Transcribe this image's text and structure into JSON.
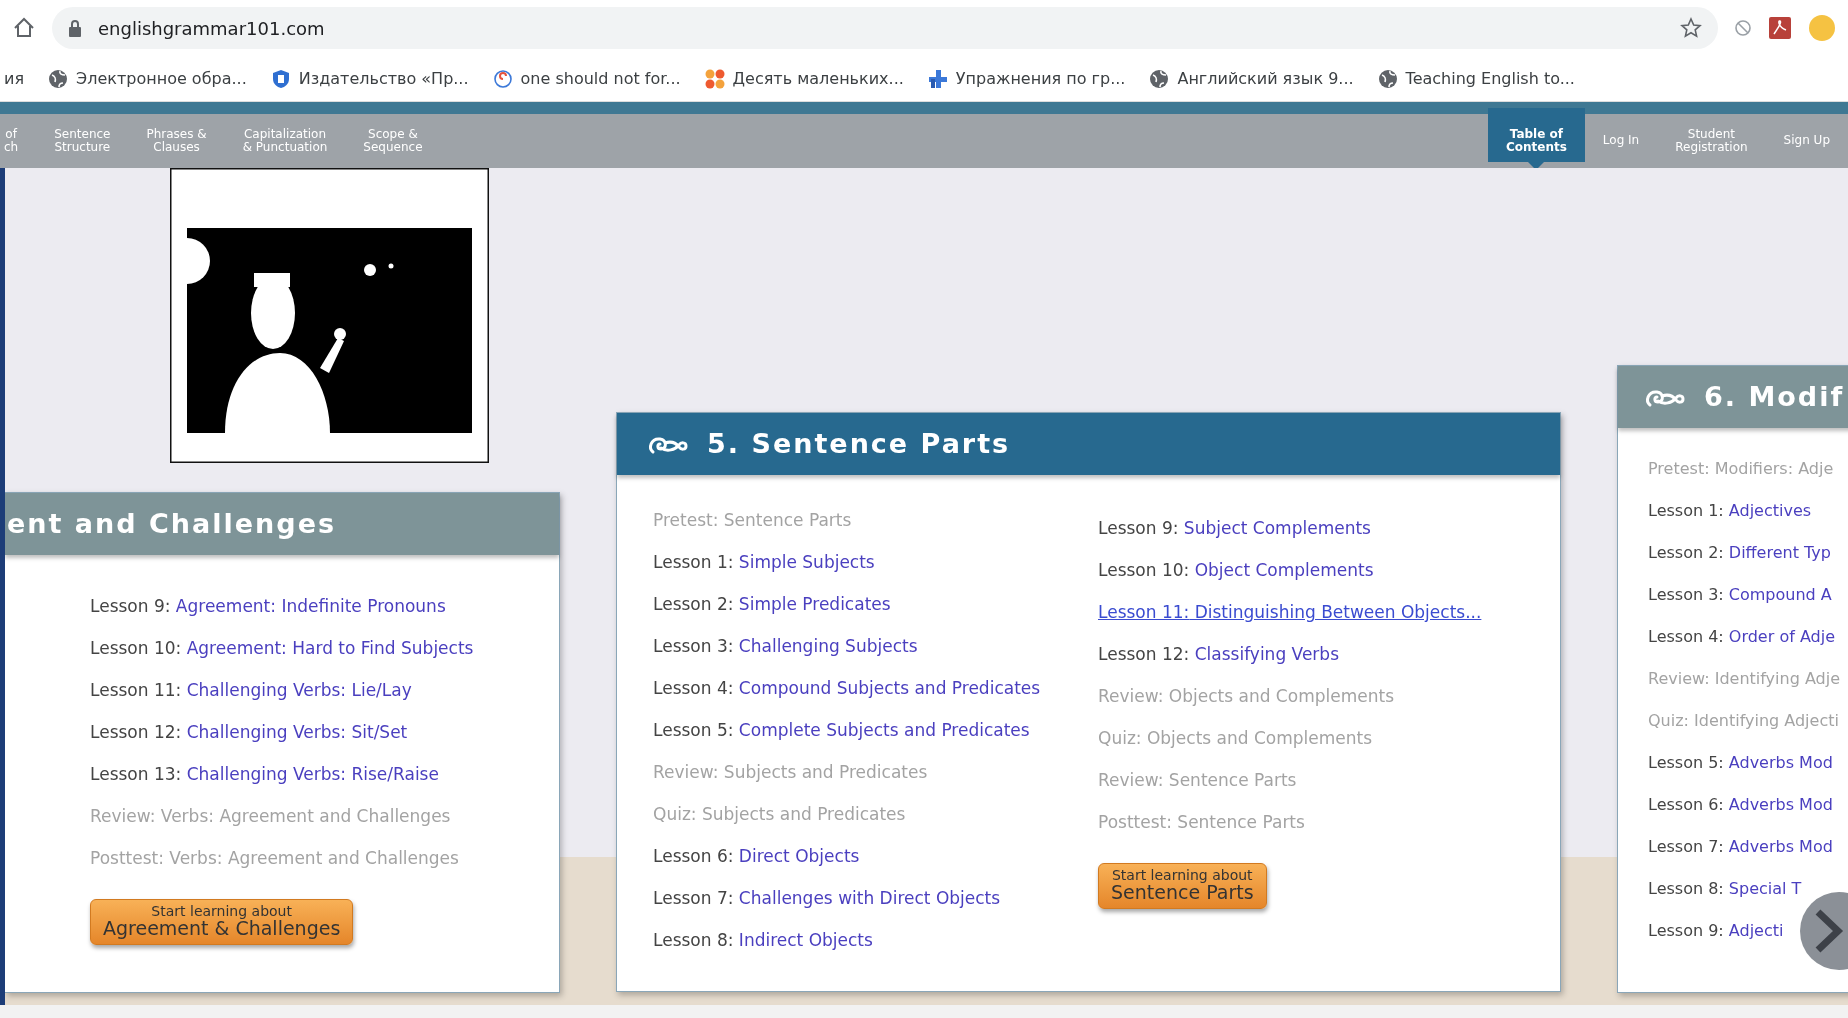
{
  "browser": {
    "url": "englishgrammar101.com",
    "bookmarks": [
      {
        "kind": "plain",
        "label": "ия"
      },
      {
        "kind": "globe",
        "label": "Электронное обра..."
      },
      {
        "kind": "shield",
        "label": "Издательство «Пр..."
      },
      {
        "kind": "spiral",
        "label": "one should not for..."
      },
      {
        "kind": "dots",
        "label": "Десять маленьких..."
      },
      {
        "kind": "cross",
        "label": "Упражнения по гр..."
      },
      {
        "kind": "globe",
        "label": "Английский язык 9..."
      },
      {
        "kind": "globe",
        "label": "Teaching English to..."
      }
    ]
  },
  "nav": {
    "left": [
      {
        "lines": [
          "of",
          "ch"
        ],
        "selected": false
      },
      {
        "lines": [
          "Sentence",
          "Structure"
        ],
        "selected": false
      },
      {
        "lines": [
          "Phrases &",
          "Clauses"
        ],
        "selected": false
      },
      {
        "lines": [
          "Capitalization",
          "& Punctuation"
        ],
        "selected": false
      },
      {
        "lines": [
          "Scope &",
          "Sequence"
        ],
        "selected": false
      }
    ],
    "right": [
      {
        "lines": [
          "Table of",
          "Contents"
        ],
        "selected": true
      },
      {
        "lines": [
          "Log In"
        ],
        "selected": false
      },
      {
        "lines": [
          "Student",
          "Registration"
        ],
        "selected": false
      },
      {
        "lines": [
          "Sign Up"
        ],
        "selected": false
      }
    ]
  },
  "units": [
    {
      "title": "ent and Challenges",
      "icon_shown": false,
      "active": false,
      "columns": [
        [
          {
            "kind": "lesson",
            "prefix": "Lesson 9:",
            "link": "Agreement: Indefinite Pronouns",
            "hovered": false
          },
          {
            "kind": "lesson",
            "prefix": "Lesson 10:",
            "link": "Agreement: Hard to Find Subjects",
            "hovered": false
          },
          {
            "kind": "lesson",
            "prefix": "Lesson 11:",
            "link": "Challenging Verbs: Lie/Lay",
            "hovered": false
          },
          {
            "kind": "lesson",
            "prefix": "Lesson 12:",
            "link": "Challenging Verbs: Sit/Set",
            "hovered": false
          },
          {
            "kind": "lesson",
            "prefix": "Lesson 13:",
            "link": "Challenging Verbs: Rise/Raise",
            "hovered": false
          },
          {
            "kind": "test",
            "text": "Review: Verbs: Agreement and Challenges"
          },
          {
            "kind": "test",
            "text": "Posttest: Verbs: Agreement and Challenges"
          }
        ]
      ],
      "button": {
        "line1": "Start learning about",
        "line2": "Agreement & Challenges"
      }
    },
    {
      "title": "5. Sentence Parts",
      "icon_shown": true,
      "active": true,
      "columns": [
        [
          {
            "kind": "test",
            "text": "Pretest: Sentence Parts"
          },
          {
            "kind": "lesson",
            "prefix": "Lesson 1:",
            "link": "Simple Subjects",
            "hovered": false
          },
          {
            "kind": "lesson",
            "prefix": "Lesson 2:",
            "link": "Simple Predicates",
            "hovered": false
          },
          {
            "kind": "lesson",
            "prefix": "Lesson 3:",
            "link": "Challenging Subjects",
            "hovered": false
          },
          {
            "kind": "lesson",
            "prefix": "Lesson 4:",
            "link": "Compound Subjects and Predicates",
            "hovered": false
          },
          {
            "kind": "lesson",
            "prefix": "Lesson 5:",
            "link": "Complete Subjects and Predicates",
            "hovered": false
          },
          {
            "kind": "test",
            "text": "Review: Subjects and Predicates"
          },
          {
            "kind": "test",
            "text": "Quiz: Subjects and Predicates"
          },
          {
            "kind": "lesson",
            "prefix": "Lesson 6:",
            "link": "Direct Objects",
            "hovered": false
          },
          {
            "kind": "lesson",
            "prefix": "Lesson 7:",
            "link": "Challenges with Direct Objects",
            "hovered": false
          },
          {
            "kind": "lesson",
            "prefix": "Lesson 8:",
            "link": "Indirect Objects",
            "hovered": false
          }
        ],
        [
          {
            "kind": "lesson",
            "prefix": "Lesson 9:",
            "link": "Subject Complements",
            "hovered": false
          },
          {
            "kind": "lesson",
            "prefix": "Lesson 10:",
            "link": "Object Complements",
            "hovered": false
          },
          {
            "kind": "lesson",
            "prefix": "Lesson 11:",
            "link": "Distinguishing Between Objects...",
            "hovered": true
          },
          {
            "kind": "lesson",
            "prefix": "Lesson 12:",
            "link": "Classifying Verbs",
            "hovered": false
          },
          {
            "kind": "test",
            "text": "Review: Objects and Complements"
          },
          {
            "kind": "test",
            "text": "Quiz: Objects and Complements"
          },
          {
            "kind": "test",
            "text": "Review: Sentence Parts"
          },
          {
            "kind": "test",
            "text": "Posttest: Sentence Parts"
          }
        ]
      ],
      "button": {
        "line1": "Start learning about",
        "line2": "Sentence Parts"
      }
    },
    {
      "title": "6. Modif",
      "icon_shown": true,
      "active": false,
      "columns": [
        [
          {
            "kind": "test",
            "text": "Pretest: Modifiers: Adje"
          },
          {
            "kind": "lesson",
            "prefix": "Lesson 1:",
            "link": "Adjectives",
            "hovered": false
          },
          {
            "kind": "lesson",
            "prefix": "Lesson 2:",
            "link": "Different Typ",
            "hovered": false
          },
          {
            "kind": "lesson",
            "prefix": "Lesson 3:",
            "link": "Compound A",
            "hovered": false
          },
          {
            "kind": "lesson",
            "prefix": "Lesson 4:",
            "link": "Order of Adje",
            "hovered": false
          },
          {
            "kind": "test",
            "text": "Review: Identifying Adje"
          },
          {
            "kind": "test",
            "text": "Quiz: Identifying Adjecti"
          },
          {
            "kind": "lesson",
            "prefix": "Lesson 5:",
            "link": "Adverbs Mod",
            "hovered": false
          },
          {
            "kind": "lesson",
            "prefix": "Lesson 6:",
            "link": "Adverbs Mod",
            "hovered": false
          },
          {
            "kind": "lesson",
            "prefix": "Lesson 7:",
            "link": "Adverbs Mod",
            "hovered": false
          },
          {
            "kind": "lesson",
            "prefix": "Lesson 8:",
            "link": "Special T",
            "hovered": false
          },
          {
            "kind": "lesson",
            "prefix": "Lesson 9:",
            "link": "Adjecti",
            "hovered": false
          }
        ]
      ]
    }
  ]
}
